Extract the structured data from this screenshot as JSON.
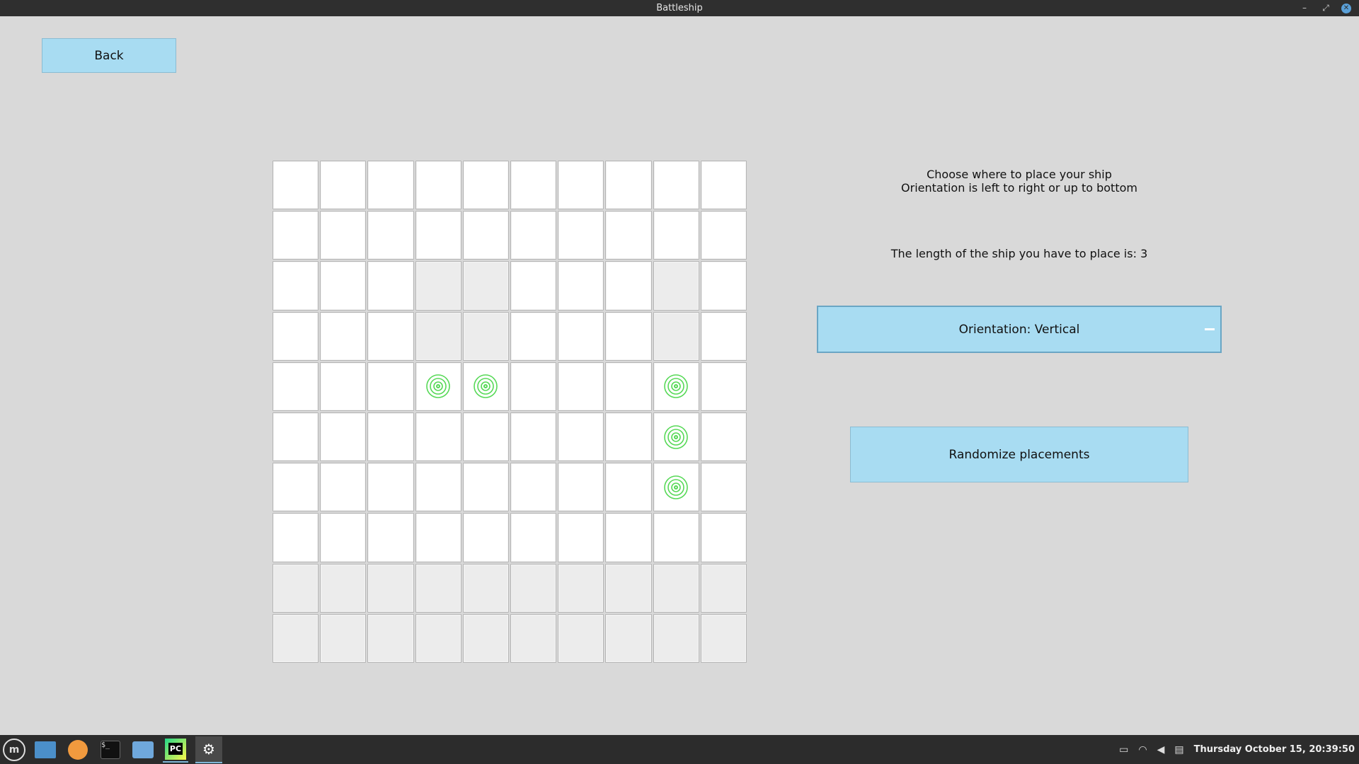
{
  "window": {
    "title": "Battleship",
    "minimize_label": "–",
    "maximize_label": "⤢",
    "close_label": "✕"
  },
  "back_button": {
    "label": "Back"
  },
  "instructions": {
    "line1": "Choose where to place your ship",
    "line2": "Orientation is left to right or up to bottom",
    "ship_length_text": "The length of the ship you have to place is: 3"
  },
  "orientation_button": {
    "label": "Orientation: Vertical"
  },
  "randomize_button": {
    "label": "Randomize placements"
  },
  "board": {
    "rows": 10,
    "cols": 10,
    "shaded_cells": [
      [
        2,
        3
      ],
      [
        2,
        4
      ],
      [
        2,
        8
      ],
      [
        3,
        3
      ],
      [
        3,
        4
      ],
      [
        3,
        8
      ],
      [
        8,
        0
      ],
      [
        8,
        1
      ],
      [
        8,
        2
      ],
      [
        8,
        3
      ],
      [
        8,
        4
      ],
      [
        8,
        5
      ],
      [
        8,
        6
      ],
      [
        8,
        7
      ],
      [
        8,
        8
      ],
      [
        8,
        9
      ],
      [
        9,
        0
      ],
      [
        9,
        1
      ],
      [
        9,
        2
      ],
      [
        9,
        3
      ],
      [
        9,
        4
      ],
      [
        9,
        5
      ],
      [
        9,
        6
      ],
      [
        9,
        7
      ],
      [
        9,
        8
      ],
      [
        9,
        9
      ]
    ],
    "target_cells": [
      [
        4,
        3
      ],
      [
        4,
        4
      ],
      [
        4,
        8
      ],
      [
        5,
        8
      ],
      [
        6,
        8
      ]
    ],
    "target_color": "#57d957"
  },
  "taskbar": {
    "apps": [
      "mint-menu-icon",
      "files-icon",
      "firefox-icon",
      "terminal-icon",
      "folder-icon",
      "pycharm-icon",
      "settings-icon"
    ],
    "terminal_glyph": "$_",
    "pycharm_label": "PC",
    "settings_glyph": "⚙",
    "menu_glyph": "m",
    "clock": "Thursday October 15, 20:39:50"
  },
  "colors": {
    "button": "#a8dcf2",
    "background": "#d9d9d9"
  }
}
